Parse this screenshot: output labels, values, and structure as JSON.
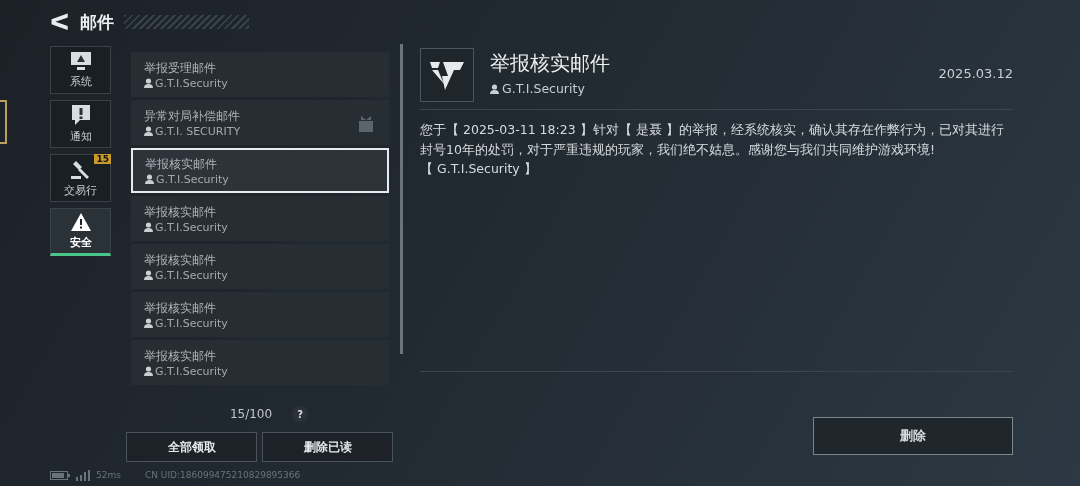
{
  "header": {
    "back_icon": "ᐸ",
    "title": "邮件"
  },
  "categories": [
    {
      "label": "系统",
      "selected": false
    },
    {
      "label": "通知",
      "selected": false
    },
    {
      "label": "交易行",
      "selected": false,
      "badge": "15"
    },
    {
      "label": "安全",
      "selected": true
    }
  ],
  "mails": [
    {
      "title": "举报受理邮件",
      "sender": "G.T.I.Security",
      "selected": false,
      "attachment": false
    },
    {
      "title": "异常对局补偿邮件",
      "sender": "G.T.I. SECURITY",
      "selected": false,
      "attachment": true
    },
    {
      "title": "举报核实邮件",
      "sender": "G.T.I.Security",
      "selected": true,
      "attachment": false
    },
    {
      "title": "举报核实邮件",
      "sender": "G.T.I.Security",
      "selected": false,
      "attachment": false
    },
    {
      "title": "举报核实邮件",
      "sender": "G.T.I.Security",
      "selected": false,
      "attachment": false
    },
    {
      "title": "举报核实邮件",
      "sender": "G.T.I.Security",
      "selected": false,
      "attachment": false
    },
    {
      "title": "举报核实邮件",
      "sender": "G.T.I.Security",
      "selected": false,
      "attachment": false
    }
  ],
  "mail_count": "15/100",
  "help": "?",
  "list_buttons": [
    "全部领取",
    "删除已读"
  ],
  "detail": {
    "title": "举报核实邮件",
    "sender": "G.T.I.Security",
    "date": "2025.03.12",
    "body": [
      "您于【 2025-03-11 18:23 】针对【 是聂 】的举报，经系统核实，确认其存在作弊行为，已对其进行封号10年的处罚，对于严重违规的玩家，我们绝不姑息。感谢您与我们共同维护游戏环境!",
      "【 G.T.I.Security 】"
    ],
    "delete_button": "删除"
  },
  "status_bar": {
    "ping": "52ms",
    "uid": "CN UID:186099475210829895366"
  }
}
